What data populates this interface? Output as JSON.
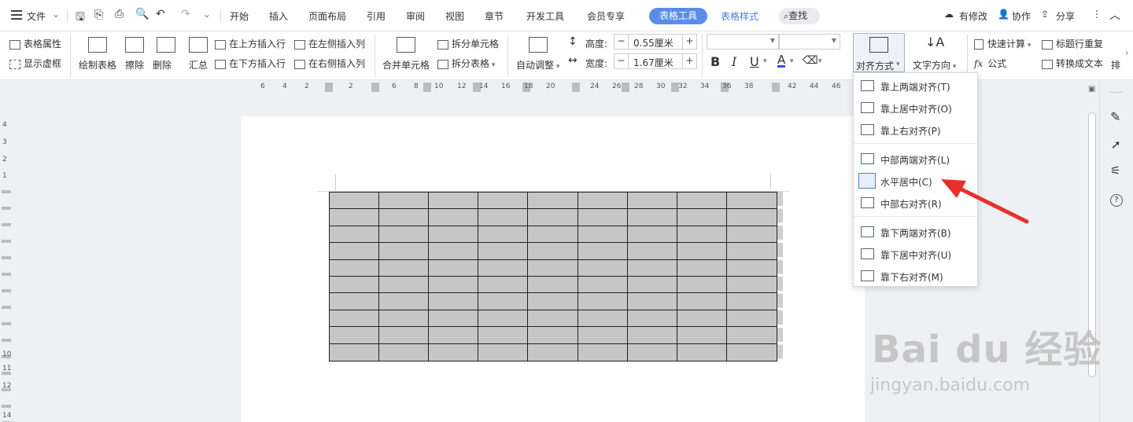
{
  "menubar": {
    "file_label": "文件",
    "tabs": [
      "开始",
      "插入",
      "页面布局",
      "引用",
      "审阅",
      "视图",
      "章节",
      "开发工具",
      "会员专享"
    ],
    "active_tab": "表格工具",
    "extra_tab": "表格样式",
    "search_label": "查找",
    "modified_label": "有修改",
    "collab_label": "协作",
    "share_label": "分享"
  },
  "ribbon": {
    "table_props": "表格属性",
    "show_gridlines": "显示虚框",
    "draw_table": "绘制表格",
    "erase": "擦除",
    "delete": "删除",
    "summary": "汇总",
    "insert_row_above": "在上方插入行",
    "insert_row_below": "在下方插入行",
    "insert_col_left": "在左侧插入列",
    "insert_col_right": "在右侧插入列",
    "merge_cells": "合并单元格",
    "split_cells": "拆分单元格",
    "split_table": "拆分表格",
    "auto_adjust": "自动调整",
    "height_label": "高度:",
    "height_value": "0.55厘米",
    "width_label": "宽度:",
    "width_value": "1.67厘米",
    "align_label": "对齐方式",
    "text_direction": "文字方向",
    "quick_calc": "快速计算",
    "formula": "公式",
    "repeat_header": "标题行重复",
    "convert_text": "转换成文本",
    "sort_partial": "排"
  },
  "ruler_h": [
    "6",
    "4",
    "2",
    "2",
    "4",
    "6",
    "8",
    "10",
    "12",
    "14",
    "16",
    "18",
    "20",
    "22",
    "24",
    "26",
    "28",
    "30",
    "32",
    "34",
    "36",
    "38",
    "40",
    "42",
    "44",
    "46"
  ],
  "ruler_v": [
    "4",
    "3",
    "2",
    "1",
    "1",
    "2",
    "10",
    "11",
    "12",
    "14"
  ],
  "alignment_menu": {
    "items": [
      {
        "label": "靠上两端对齐(T)"
      },
      {
        "label": "靠上居中对齐(O)"
      },
      {
        "label": "靠上右对齐(P)"
      },
      {
        "label": "中部两端对齐(L)"
      },
      {
        "label": "水平居中(C)"
      },
      {
        "label": "中部右对齐(R)"
      },
      {
        "label": "靠下两端对齐(B)"
      },
      {
        "label": "靠下居中对齐(U)"
      },
      {
        "label": "靠下右对齐(M)"
      }
    ]
  },
  "table": {
    "rows": 10,
    "cols": 9,
    "fill_color": "#c6c6c6"
  },
  "colors": {
    "accent": "#5b8de8",
    "arrow": "#e8302a"
  },
  "watermark": {
    "main": "Bai du 经验",
    "sub": "jingyan.baidu.com"
  }
}
